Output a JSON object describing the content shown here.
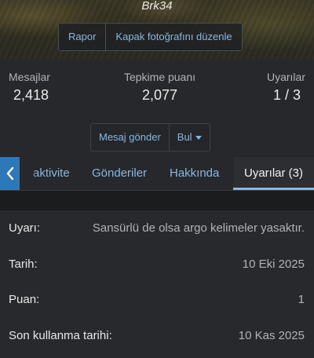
{
  "profile": {
    "username": "Brk34",
    "cover_actions": {
      "report_label": "Rapor",
      "edit_cover_label": "Kapak fotoğrafını düzenle"
    }
  },
  "stats": {
    "messages": {
      "label": "Mesajlar",
      "value": "2,418"
    },
    "reaction_score": {
      "label": "Tepkime puanı",
      "value": "2,077"
    },
    "warnings": {
      "label": "Uyarılar",
      "value": "1 / 3"
    }
  },
  "actions": {
    "send_message_label": "Mesaj gönder",
    "find_label": "Bul"
  },
  "tabs": {
    "activity": "aktivite",
    "posts": "Gönderiler",
    "about": "Hakkında",
    "warnings": "Uyarılar (3)",
    "active": "warnings"
  },
  "warning_details": {
    "rows": [
      {
        "label": "Uyarı:",
        "value": "Sansürlü de olsa argo kelimeler yasaktır."
      },
      {
        "label": "Tarih:",
        "value": "10 Eki 2025"
      },
      {
        "label": "Puan:",
        "value": "1"
      },
      {
        "label": "Son kullanma tarihi:",
        "value": "10 Kas 2025"
      }
    ]
  },
  "colors": {
    "link": "#8ab6e0",
    "accent": "#2f78b8",
    "background": "#232427"
  },
  "icons": {
    "tab_prev": "chevron-left-icon",
    "find_dropdown": "caret-down-icon"
  }
}
